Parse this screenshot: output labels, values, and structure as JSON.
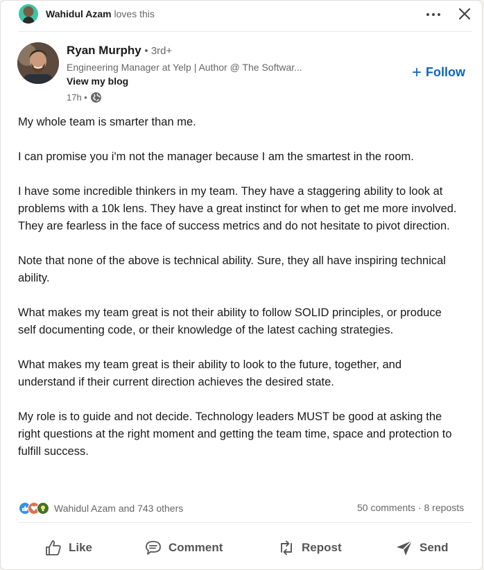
{
  "activity": {
    "actor": "Wahidul Azam",
    "action": "loves this"
  },
  "author": {
    "name": "Ryan Murphy",
    "degree": "• 3rd+",
    "headline": "Engineering Manager at Yelp | Author @ The Softwar...",
    "link_label": "View my blog",
    "time": "17h •"
  },
  "follow_label": "Follow",
  "post": {
    "paragraphs": [
      "My whole team is smarter than me.",
      "I can promise you i'm not the manager because I am the smartest in the room.",
      "I have some incredible thinkers in my team. They have a staggering ability to look at problems with a 10k lens. They have a great instinct for when to get me more involved. They are fearless in the face of success metrics and do not hesitate to pivot direction.",
      "Note that none of the above is technical ability. Sure, they all have inspiring technical ability.",
      "What makes my team great is not their ability to follow SOLID principles, or produce self documenting code, or their knowledge of the latest caching strategies.",
      "What makes my team great is their ability to look to the future, together, and understand if their current direction achieves the desired state.",
      "My role is to guide and not decide. Technology leaders MUST be good at asking the right questions at the right moment and getting the team time, space and protection to fulfill success."
    ]
  },
  "social": {
    "reactions_text": "Wahidul Azam and 743 others",
    "comments": "50 comments",
    "separator": "·",
    "reposts": "8 reposts",
    "reaction_icons": [
      "like-icon",
      "love-icon",
      "insightful-icon"
    ]
  },
  "actions": {
    "like": "Like",
    "comment": "Comment",
    "repost": "Repost",
    "send": "Send"
  },
  "colors": {
    "accent": "#0a66c2",
    "like": "#378fe9",
    "love": "#df704d",
    "insightful": "#44712e"
  }
}
